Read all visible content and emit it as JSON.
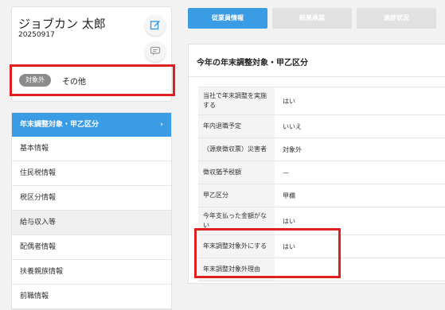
{
  "profile": {
    "name": "ジョブカン 太郎",
    "id": "20250917",
    "status_badge": "対象外",
    "status_text": "その他"
  },
  "menu": [
    {
      "label": "年末調整対象・甲乙区分",
      "active": true
    },
    {
      "label": "基本情報"
    },
    {
      "label": "住民税情報"
    },
    {
      "label": "税区分情報"
    },
    {
      "label": "給与収入等"
    },
    {
      "label": "配偶者情報"
    },
    {
      "label": "扶養親族情報"
    },
    {
      "label": "前職情報"
    }
  ],
  "tabs": [
    "従業員情報",
    "結果承認",
    "進捗状況"
  ],
  "panel": {
    "title": "今年の年末調整対象・甲乙区分",
    "rows": [
      {
        "label": "当社で年末調整を実施する",
        "value": "はい"
      },
      {
        "label": "年内退職予定",
        "value": "いいえ"
      },
      {
        "label": "（源泉徴収票）災害者",
        "value": "対象外"
      },
      {
        "label": "徴収猶予税額",
        "value": "—"
      },
      {
        "label": "甲乙区分",
        "value": "甲欄"
      },
      {
        "label": "今年支払った金額がない",
        "value": "はい"
      },
      {
        "label": "年末調整対象外にする",
        "value": "はい"
      },
      {
        "label": "年末調整対象外理由",
        "value": ""
      }
    ]
  },
  "colors": {
    "accent": "#3b9ce6",
    "highlight_border": "#e0201e",
    "badge": "#8c8c8c"
  },
  "icons": [
    "edit-icon",
    "chat-icon",
    "chevron-right-icon"
  ]
}
